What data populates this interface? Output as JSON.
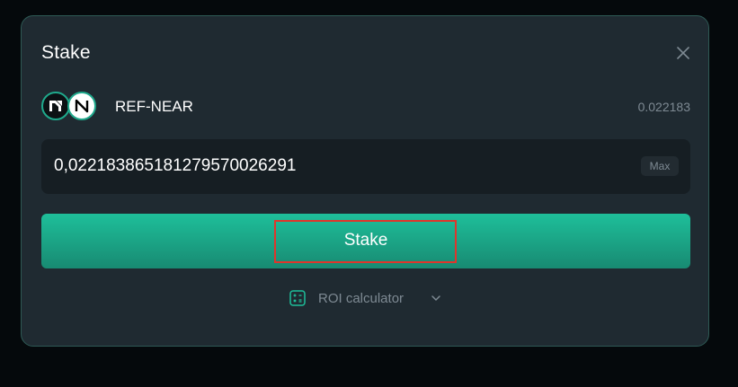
{
  "dialog": {
    "title": "Stake",
    "close_icon": "close-icon"
  },
  "token": {
    "name": "REF-NEAR",
    "balance": "0.022183",
    "icons": [
      "ref-token-icon",
      "near-token-icon"
    ]
  },
  "amount_input": {
    "value": "0,02218386518127957002629​1",
    "max_label": "Max"
  },
  "stake_button": {
    "label": "Stake"
  },
  "roi": {
    "label": "ROI calculator",
    "icon": "calculator-icon",
    "chevron": "chevron-down-icon"
  },
  "colors": {
    "accent": "#1ebf9a",
    "highlight": "#e0352b",
    "panel": "#1f2a31"
  }
}
